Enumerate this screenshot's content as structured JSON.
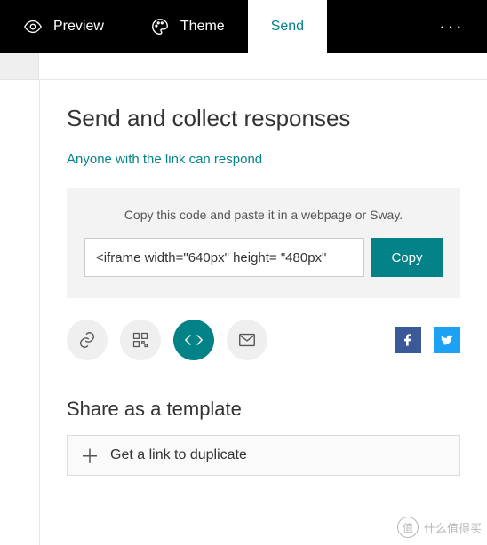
{
  "topbar": {
    "preview": "Preview",
    "theme": "Theme",
    "send": "Send"
  },
  "main": {
    "heading": "Send and collect responses",
    "subtitle": "Anyone with the link can respond",
    "codebox": {
      "hint": "Copy this code and paste it in a webpage or Sway.",
      "code": "<iframe width=\"640px\" height= \"480px\"",
      "copy": "Copy"
    },
    "share_icons": {
      "link": "link-icon",
      "qr": "qr-icon",
      "embed": "embed-icon",
      "email": "email-icon",
      "facebook": "facebook-icon",
      "twitter": "twitter-icon"
    },
    "template": {
      "heading": "Share as a template",
      "link": "Get a link to duplicate"
    }
  },
  "watermark": {
    "badge": "值",
    "text": "什么值得买"
  }
}
